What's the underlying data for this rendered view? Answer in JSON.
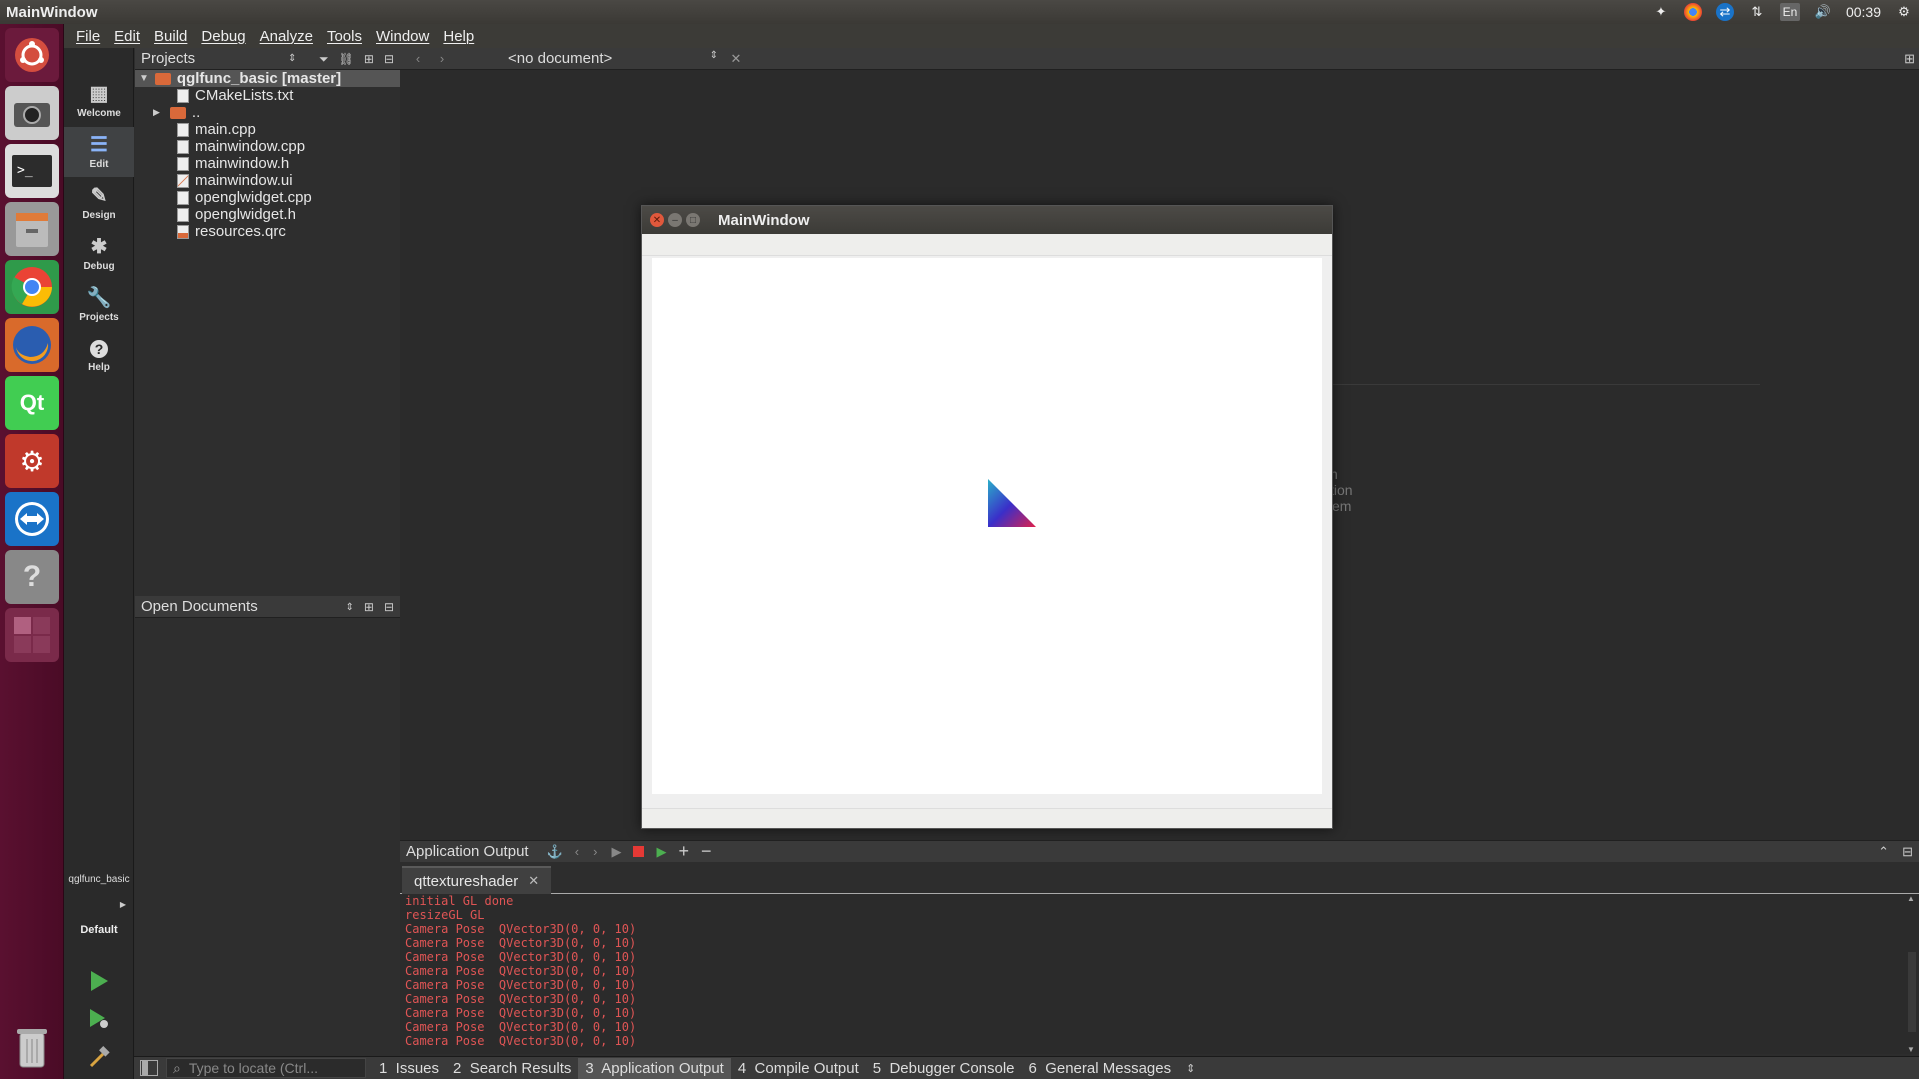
{
  "system_bar": {
    "title": "MainWindow",
    "tray": {
      "keyboard": "En",
      "clock": "00:39"
    }
  },
  "menubar": {
    "items": [
      "File",
      "Edit",
      "Build",
      "Debug",
      "Analyze",
      "Tools",
      "Window",
      "Help"
    ]
  },
  "modes": [
    {
      "label": "Welcome",
      "icon": "grid-icon"
    },
    {
      "label": "Edit",
      "icon": "document-icon"
    },
    {
      "label": "Design",
      "icon": "pencil-icon"
    },
    {
      "label": "Debug",
      "icon": "bug-icon"
    },
    {
      "label": "Projects",
      "icon": "wrench-icon"
    },
    {
      "label": "Help",
      "icon": "question-icon"
    }
  ],
  "kit_selector": {
    "project": "qglfunc_basic",
    "build": "Default"
  },
  "projects_panel": {
    "title": "Projects",
    "root": "qglfunc_basic [master]",
    "files": [
      "CMakeLists.txt",
      "..",
      "main.cpp",
      "mainwindow.cpp",
      "mainwindow.h",
      "mainwindow.ui",
      "openglwidget.cpp",
      "openglwidget.h",
      "resources.qrc"
    ]
  },
  "open_documents": {
    "title": "Open Documents"
  },
  "editor": {
    "document_selector": "<no document>"
  },
  "app_window": {
    "title": "MainWindow"
  },
  "background_text": [
    "n",
    "tion",
    "em"
  ],
  "output": {
    "title": "Application Output",
    "tab": "qttextureshader",
    "lines": [
      "initial GL done",
      "resizeGL GL",
      "Camera Pose  QVector3D(0, 0, 10)",
      "Camera Pose  QVector3D(0, 0, 10)",
      "Camera Pose  QVector3D(0, 0, 10)",
      "Camera Pose  QVector3D(0, 0, 10)",
      "Camera Pose  QVector3D(0, 0, 10)",
      "Camera Pose  QVector3D(0, 0, 10)",
      "Camera Pose  QVector3D(0, 0, 10)",
      "Camera Pose  QVector3D(0, 0, 10)",
      "Camera Pose  QVector3D(0, 0, 10)"
    ]
  },
  "statusbar": {
    "locator_placeholder": "Type to locate (Ctrl...",
    "tabs": [
      "1  Issues",
      "2  Search Results",
      "3  Application Output",
      "4  Compile Output",
      "5  Debugger Console",
      "6  General Messages"
    ],
    "active_tab": 2
  },
  "colors": {
    "launcher": "#4a0b26",
    "output_text": "#e05555",
    "accent_run": "#4caf50"
  }
}
